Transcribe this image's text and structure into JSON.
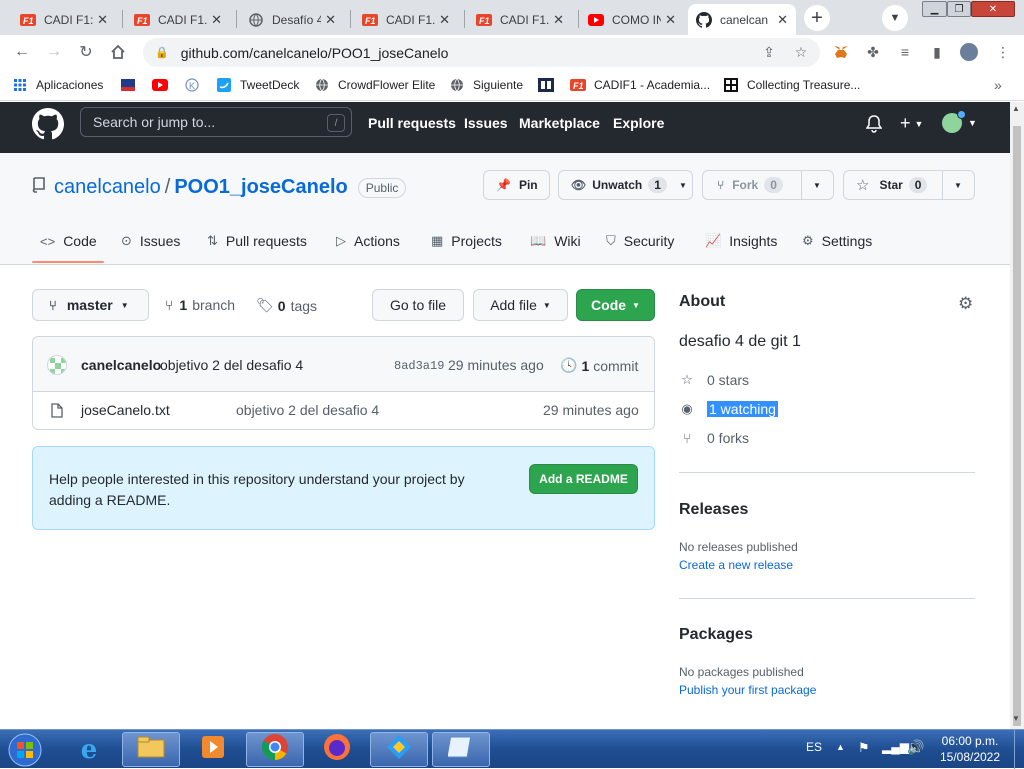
{
  "browser": {
    "tabs": [
      {
        "title": "CADI F1:",
        "icon": "cadi-icon"
      },
      {
        "title": "CADI F1.",
        "icon": "cadi-icon"
      },
      {
        "title": "Desafío 4",
        "icon": "globe-icon"
      },
      {
        "title": "CADI F1.",
        "icon": "cadi-icon"
      },
      {
        "title": "CADI F1.",
        "icon": "cadi-icon"
      },
      {
        "title": "COMO IN",
        "icon": "youtube-icon"
      },
      {
        "title": "canelcan",
        "icon": "github-icon"
      }
    ],
    "url": "github.com/canelcanelo/POO1_joseCanelo",
    "bookmarks": [
      {
        "label": "Aplicaciones",
        "icon": "apps-grid-icon"
      },
      {
        "label": "",
        "icon": "bookmark-logo-icon"
      },
      {
        "label": "",
        "icon": "youtube-icon"
      },
      {
        "label": "",
        "icon": "k-circle-icon"
      },
      {
        "label": "TweetDeck",
        "icon": "tweetdeck-icon"
      },
      {
        "label": "CrowdFlower Elite",
        "icon": "globe-icon"
      },
      {
        "label": "Siguiente",
        "icon": "globe-icon"
      },
      {
        "label": "",
        "icon": "site-icon"
      },
      {
        "label": "CADIF1 - Academia...",
        "icon": "cadi-icon"
      },
      {
        "label": "Collecting Treasure...",
        "icon": "grid-logo-icon"
      }
    ]
  },
  "github": {
    "search_placeholder": "Search or jump to...",
    "search_key": "/",
    "nav": [
      "Pull requests",
      "Issues",
      "Marketplace",
      "Explore"
    ],
    "owner": "canelcanelo",
    "separator": "/",
    "repo": "POO1_joseCanelo",
    "visibility": "Public",
    "pin_label": "Pin",
    "unwatch_label": "Unwatch",
    "unwatch_count": "1",
    "fork_label": "Fork",
    "fork_count": "0",
    "star_label": "Star",
    "star_count": "0",
    "tabs": [
      "Code",
      "Issues",
      "Pull requests",
      "Actions",
      "Projects",
      "Wiki",
      "Security",
      "Insights",
      "Settings"
    ],
    "branch": "master",
    "branch_count": "1",
    "branch_word": "branch",
    "tag_count": "0",
    "tag_word": "tags",
    "go_to_file": "Go to file",
    "add_file": "Add file",
    "code_button": "Code",
    "commit": {
      "author": "canelcanelo",
      "message": "objetivo 2 del desafio 4",
      "sha": "8ad3a19",
      "time": "29 minutes ago",
      "count": "1",
      "count_word": "commit"
    },
    "files": [
      {
        "name": "joseCanelo.txt",
        "message": "objetivo 2 del desafio 4",
        "time": "29 minutes ago"
      }
    ],
    "readme_text": "Help people interested in this repository understand your project by adding a README.",
    "readme_button": "Add a README",
    "about": {
      "heading": "About",
      "description": "desafio 4 de git 1",
      "stars": "0 stars",
      "watching": "1 watching",
      "forks": "0 forks"
    },
    "releases": {
      "heading": "Releases",
      "empty": "No releases published",
      "link": "Create a new release"
    },
    "packages": {
      "heading": "Packages",
      "empty": "No packages published",
      "link": "Publish your first package"
    }
  },
  "taskbar": {
    "lang": "ES",
    "time": "06:00 p.m.",
    "date": "15/08/2022"
  },
  "colors": {
    "github_header": "#24292f",
    "green_button": "#2da44e",
    "link_blue": "#0969da",
    "selection": "#3390ff"
  }
}
